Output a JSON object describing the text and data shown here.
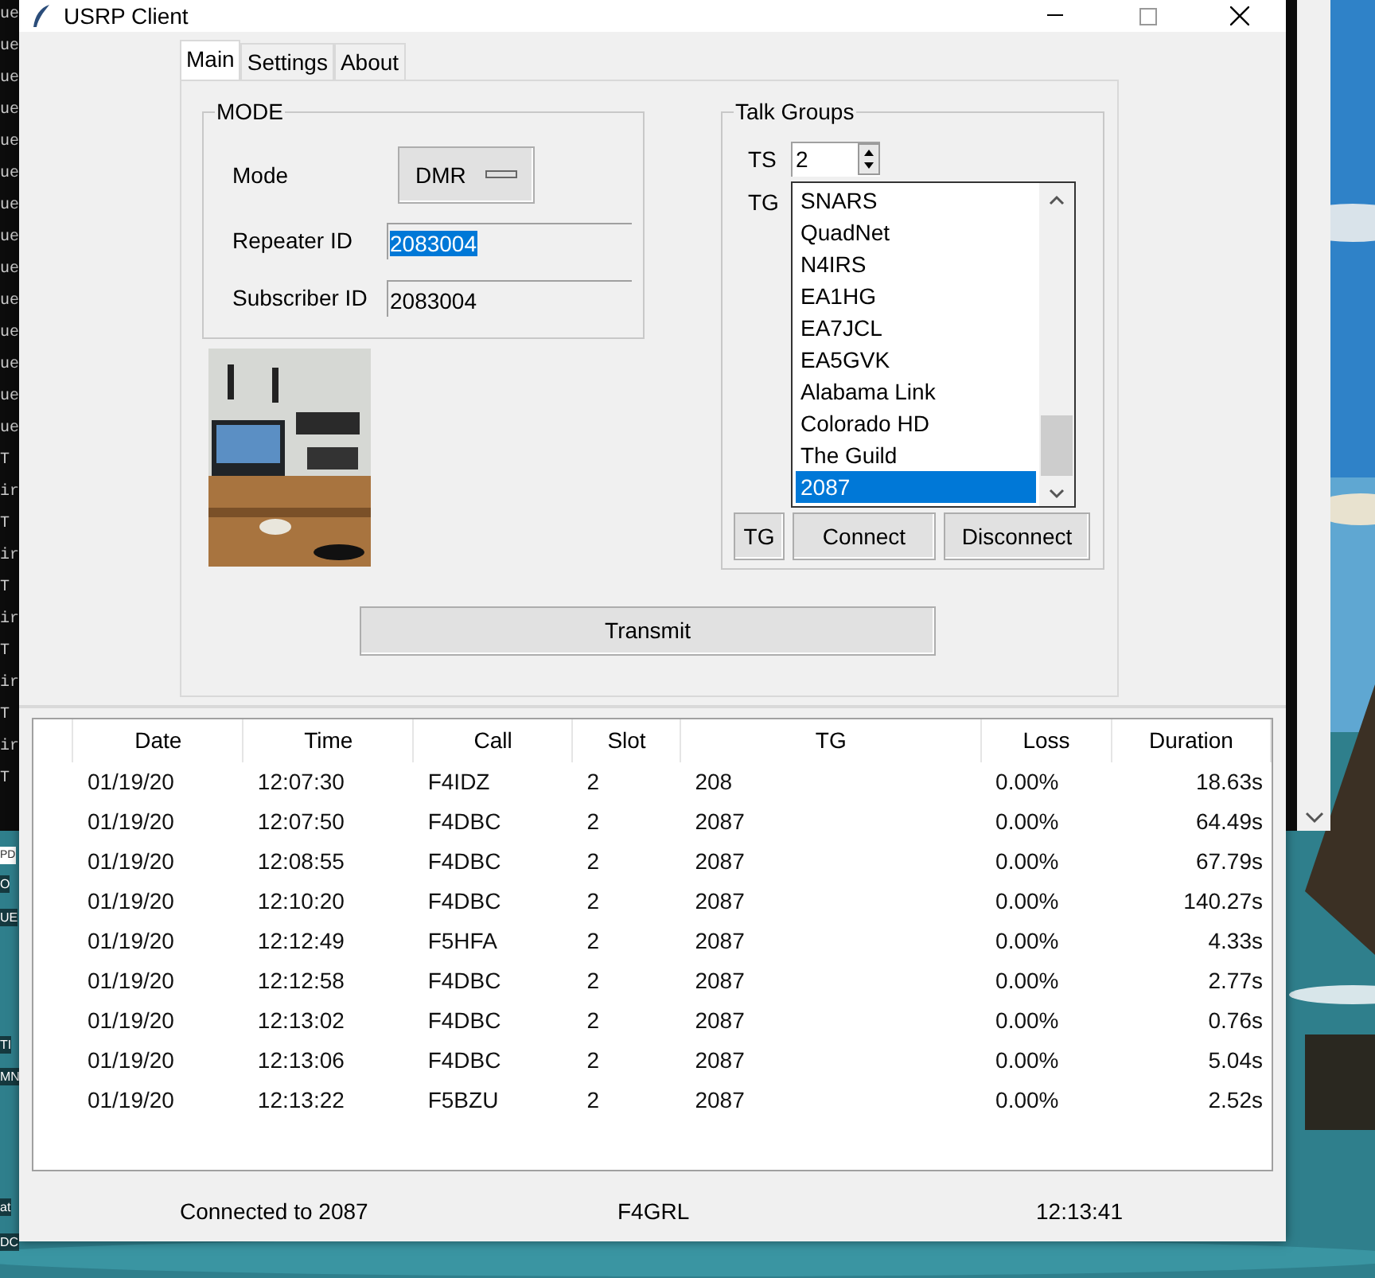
{
  "background": {
    "terminal_lines": [
      "ue",
      "ue",
      "ue",
      "ue",
      "ue",
      "ue",
      "ue",
      "ue",
      "ue",
      "ue",
      "ue",
      "ue",
      "ue",
      "ue",
      "T",
      "ir",
      "T",
      "ir",
      "T",
      "ir",
      "T",
      "ir",
      "T",
      "ir",
      "T"
    ],
    "desktop_labels": [
      "PD",
      "O",
      "UE",
      "TI",
      "MN",
      "at",
      "DC"
    ]
  },
  "window": {
    "title": "USRP Client"
  },
  "tabs": [
    {
      "label": "Main",
      "selected": true
    },
    {
      "label": "Settings",
      "selected": false
    },
    {
      "label": "About",
      "selected": false
    }
  ],
  "mode_group": {
    "title": "MODE",
    "mode_label": "Mode",
    "mode_value": "DMR",
    "repeater_id_label": "Repeater ID",
    "repeater_id": "2083004",
    "repeater_id_selected": true,
    "subscriber_id_label": "Subscriber ID",
    "subscriber_id": "2083004"
  },
  "talk_groups": {
    "title": "Talk Groups",
    "ts_label": "TS",
    "ts_value": "2",
    "tg_label": "TG",
    "items": [
      {
        "label": "SNARS",
        "selected": false
      },
      {
        "label": "QuadNet",
        "selected": false
      },
      {
        "label": "N4IRS",
        "selected": false
      },
      {
        "label": "EA1HG",
        "selected": false
      },
      {
        "label": "EA7JCL",
        "selected": false
      },
      {
        "label": "EA5GVK",
        "selected": false
      },
      {
        "label": "Alabama Link",
        "selected": false
      },
      {
        "label": "Colorado HD",
        "selected": false
      },
      {
        "label": "The Guild",
        "selected": false
      },
      {
        "label": "2087",
        "selected": true
      }
    ],
    "buttons": [
      "TG",
      "Connect",
      "Disconnect"
    ]
  },
  "transmit_button": "Transmit",
  "table": {
    "columns": [
      "Date",
      "Time",
      "Call",
      "Slot",
      "TG",
      "Loss",
      "Duration"
    ],
    "rows": [
      [
        "01/19/20",
        "12:07:30",
        "F4IDZ",
        "2",
        "208",
        "0.00%",
        "18.63s"
      ],
      [
        "01/19/20",
        "12:07:50",
        "F4DBC",
        "2",
        "2087",
        "0.00%",
        "64.49s"
      ],
      [
        "01/19/20",
        "12:08:55",
        "F4DBC",
        "2",
        "2087",
        "0.00%",
        "67.79s"
      ],
      [
        "01/19/20",
        "12:10:20",
        "F4DBC",
        "2",
        "2087",
        "0.00%",
        "140.27s"
      ],
      [
        "01/19/20",
        "12:12:49",
        "F5HFA",
        "2",
        "2087",
        "0.00%",
        "4.33s"
      ],
      [
        "01/19/20",
        "12:12:58",
        "F4DBC",
        "2",
        "2087",
        "0.00%",
        "2.77s"
      ],
      [
        "01/19/20",
        "12:13:02",
        "F4DBC",
        "2",
        "2087",
        "0.00%",
        "0.76s"
      ],
      [
        "01/19/20",
        "12:13:06",
        "F4DBC",
        "2",
        "2087",
        "0.00%",
        "5.04s"
      ],
      [
        "01/19/20",
        "12:13:22",
        "F5BZU",
        "2",
        "2087",
        "0.00%",
        "2.52s"
      ]
    ]
  },
  "status_bar": {
    "connection": "Connected to 2087",
    "callsign": "F4GRL",
    "time": "12:13:41"
  }
}
